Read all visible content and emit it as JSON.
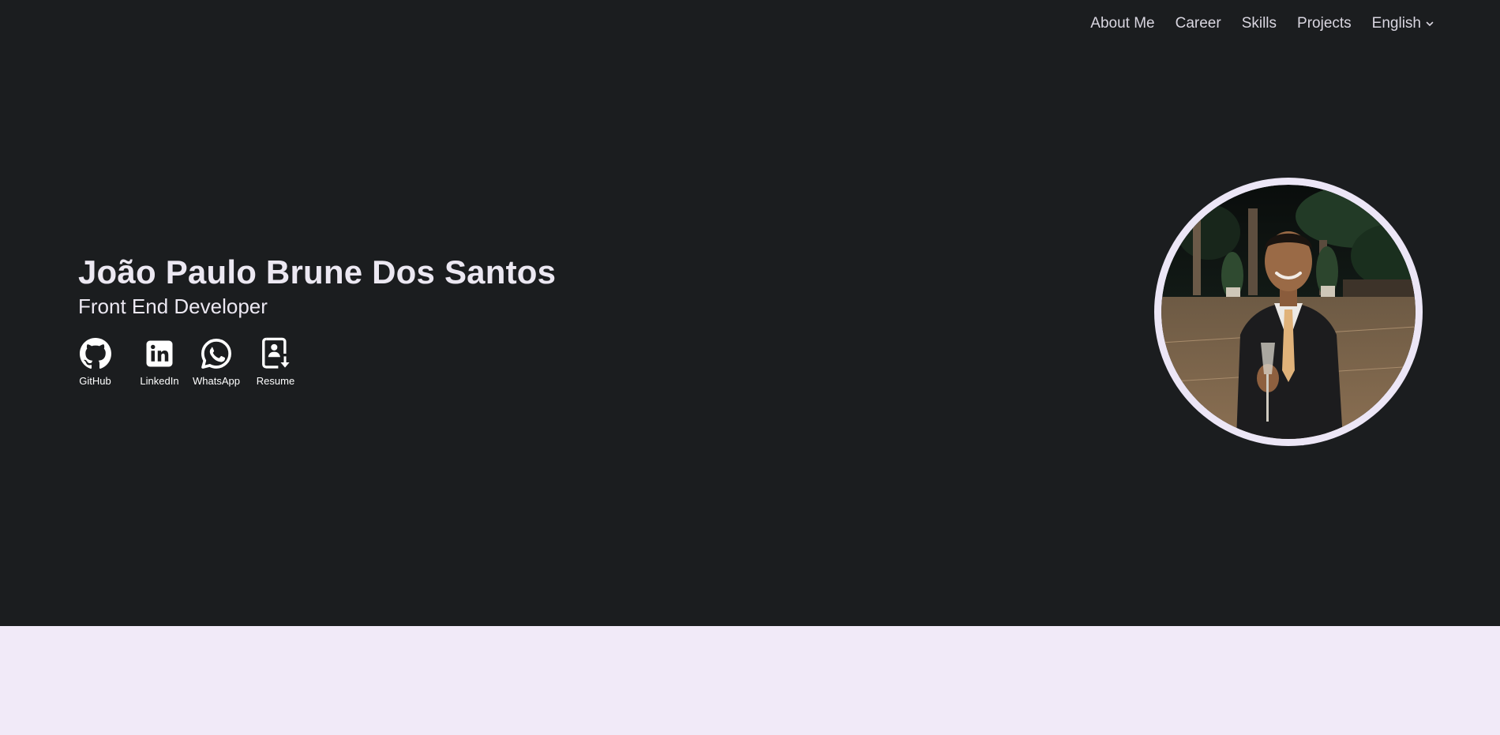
{
  "nav": {
    "items": [
      {
        "label": "About Me"
      },
      {
        "label": "Career"
      },
      {
        "label": "Skills"
      },
      {
        "label": "Projects"
      }
    ],
    "language": "English"
  },
  "hero": {
    "name": "João Paulo Brune Dos Santos",
    "role": "Front End Developer",
    "socials": [
      {
        "label": "GitHub",
        "icon": "github-icon"
      },
      {
        "label": "LinkedIn",
        "icon": "linkedin-icon"
      },
      {
        "label": "WhatsApp",
        "icon": "whatsapp-icon"
      },
      {
        "label": "Resume",
        "icon": "resume-download-icon"
      }
    ]
  },
  "colors": {
    "hero_background": "#1b1d1f",
    "page_background": "#f1eaf8",
    "avatar_border": "#ece6f6"
  }
}
